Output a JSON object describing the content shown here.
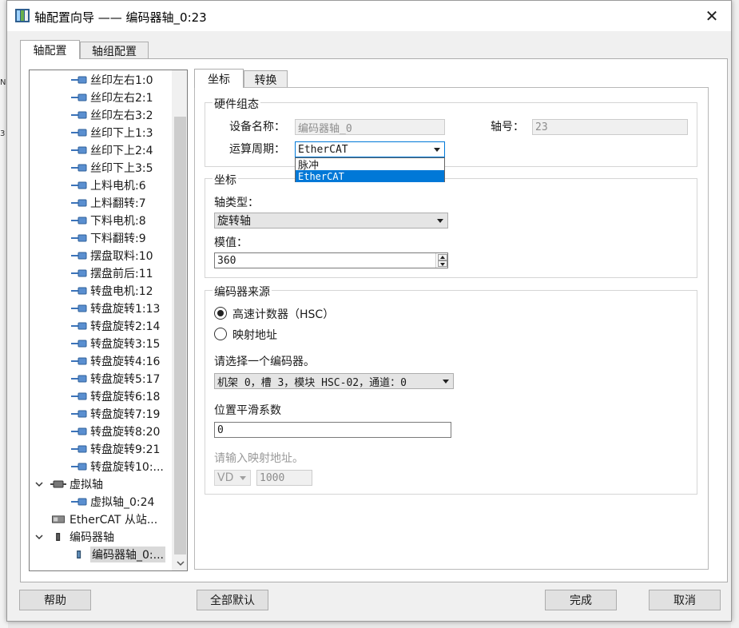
{
  "window": {
    "title": "轴配置向导 —— 编码器轴_0:23",
    "close_glyph": "✕"
  },
  "background": {
    "left_fragment_1": "N",
    "left_fragment_2": "3"
  },
  "main_tabs": [
    {
      "label": "轴配置",
      "active": true
    },
    {
      "label": "轴组配置",
      "active": false
    }
  ],
  "tree": {
    "items": [
      {
        "label": "丝印左右1:0",
        "icon": "axis-icon",
        "level": 2
      },
      {
        "label": "丝印左右2:1",
        "icon": "axis-icon",
        "level": 2
      },
      {
        "label": "丝印左右3:2",
        "icon": "axis-icon",
        "level": 2
      },
      {
        "label": "丝印下上1:3",
        "icon": "axis-icon",
        "level": 2
      },
      {
        "label": "丝印下上2:4",
        "icon": "axis-icon",
        "level": 2
      },
      {
        "label": "丝印下上3:5",
        "icon": "axis-icon",
        "level": 2
      },
      {
        "label": "上料电机:6",
        "icon": "axis-icon",
        "level": 2
      },
      {
        "label": "上料翻转:7",
        "icon": "axis-icon",
        "level": 2
      },
      {
        "label": "下料电机:8",
        "icon": "axis-icon",
        "level": 2
      },
      {
        "label": "下料翻转:9",
        "icon": "axis-icon",
        "level": 2
      },
      {
        "label": "摆盘取料:10",
        "icon": "axis-icon",
        "level": 2
      },
      {
        "label": "摆盘前后:11",
        "icon": "axis-icon",
        "level": 2
      },
      {
        "label": "转盘电机:12",
        "icon": "axis-icon",
        "level": 2
      },
      {
        "label": "转盘旋转1:13",
        "icon": "axis-icon",
        "level": 2
      },
      {
        "label": "转盘旋转2:14",
        "icon": "axis-icon",
        "level": 2
      },
      {
        "label": "转盘旋转3:15",
        "icon": "axis-icon",
        "level": 2
      },
      {
        "label": "转盘旋转4:16",
        "icon": "axis-icon",
        "level": 2
      },
      {
        "label": "转盘旋转5:17",
        "icon": "axis-icon",
        "level": 2
      },
      {
        "label": "转盘旋转6:18",
        "icon": "axis-icon",
        "level": 2
      },
      {
        "label": "转盘旋转7:19",
        "icon": "axis-icon",
        "level": 2
      },
      {
        "label": "转盘旋转8:20",
        "icon": "axis-icon",
        "level": 2
      },
      {
        "label": "转盘旋转9:21",
        "icon": "axis-icon",
        "level": 2
      },
      {
        "label": "转盘旋转10:...",
        "icon": "axis-icon",
        "level": 2
      },
      {
        "label": "虚拟轴",
        "icon": "virtual-axis-group-icon",
        "level": 1,
        "expanded": true
      },
      {
        "label": "虚拟轴_0:24",
        "icon": "axis-icon",
        "level": 2
      },
      {
        "label": "EtherCAT 从站...",
        "icon": "ethercat-slave-icon",
        "level": 1
      },
      {
        "label": "编码器轴",
        "icon": "encoder-group-icon",
        "level": 1,
        "expanded": true
      },
      {
        "label": "编码器轴_0:...",
        "icon": "encoder-axis-icon",
        "level": 2,
        "selected": true
      }
    ]
  },
  "sub_tabs": [
    {
      "label": "坐标",
      "active": true
    },
    {
      "label": "转换",
      "active": false
    }
  ],
  "hardware": {
    "title": "硬件组态",
    "device_name_label": "设备名称：",
    "device_name_value": "编码器轴_0",
    "axis_no_label": "轴号：",
    "axis_no_value": "23",
    "cycle_label": "运算周期：",
    "cycle_value": "EtherCAT",
    "cycle_options": [
      "脉冲",
      "EtherCAT"
    ]
  },
  "coords": {
    "title": "坐标",
    "axis_type_label": "轴类型：",
    "axis_type_value": "旋转轴",
    "modulo_label": "模值：",
    "modulo_value": "360"
  },
  "encoder_source": {
    "title": "编码器来源",
    "radio_hsc_label": "高速计数器（HSC）",
    "radio_map_label": "映射地址",
    "selected": "hsc",
    "select_label": "请选择一个编码器。",
    "encoder_value": "机架 0，槽 3，模块 HSC-02，通道：0",
    "smooth_label": "位置平滑系数",
    "smooth_value": "0",
    "map_label": "请输入映射地址。",
    "map_type_value": "VD",
    "map_addr_value": "1000"
  },
  "buttons": {
    "help": "帮助",
    "defaults": "全部默认",
    "finish": "完成",
    "cancel": "取消"
  }
}
